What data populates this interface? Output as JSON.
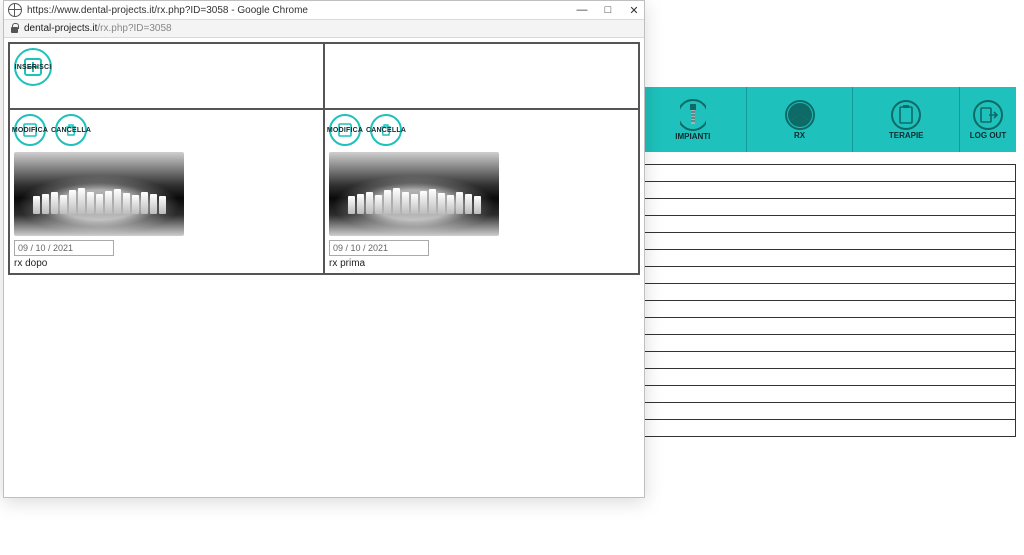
{
  "window": {
    "title": "https://www.dental-projects.it/rx.php?ID=3058 - Google Chrome",
    "minimize": "—",
    "maximize": "□",
    "close": "✕"
  },
  "address": {
    "host": "dental-projects.it",
    "path": "/rx.php?ID=3058"
  },
  "toolbar": {
    "inserisci": "INSERISCI",
    "modifica": "MODIFICA",
    "cancella": "CANCELLA"
  },
  "panels": [
    {
      "date": "09 / 10 / 2021",
      "caption": "rx dopo"
    },
    {
      "date": "09 / 10 / 2021",
      "caption": "rx prima"
    }
  ],
  "nav": {
    "impianti": "IMPIANTI",
    "rx": "RX",
    "terapie": "TERAPIE",
    "logout": "LOG OUT"
  },
  "teethHeights": [
    18,
    20,
    22,
    19,
    24,
    26,
    22,
    20,
    23,
    25,
    21,
    19,
    22,
    20,
    18
  ],
  "rowCount": 16
}
